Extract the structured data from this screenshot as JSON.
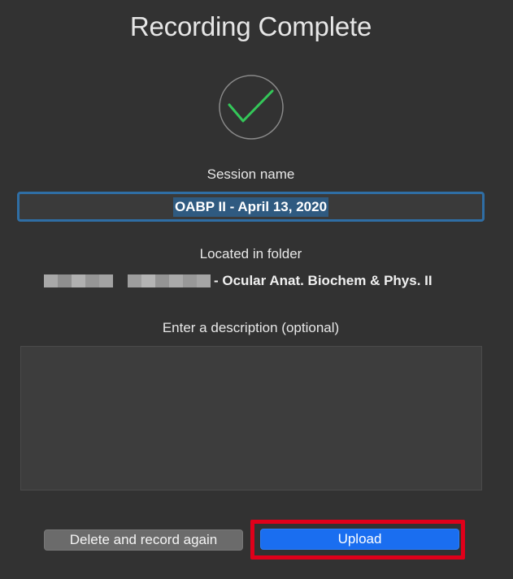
{
  "dialog": {
    "title": "Recording Complete",
    "status_icon": "checkmark-circle-icon",
    "session_label": "Session name",
    "session_value": "OABP II - April 13, 2020",
    "folder_label": "Located in folder",
    "folder_name": "- Ocular Anat. Biochem & Phys. II",
    "description_label": "Enter a description (optional)",
    "description_value": "",
    "delete_button": "Delete and record again",
    "upload_button": "Upload"
  },
  "colors": {
    "background": "#323232",
    "check_green": "#34c759",
    "focus_ring": "#2f6ea5",
    "upload_blue": "#1a6ef0",
    "highlight_red": "#e0001a"
  }
}
